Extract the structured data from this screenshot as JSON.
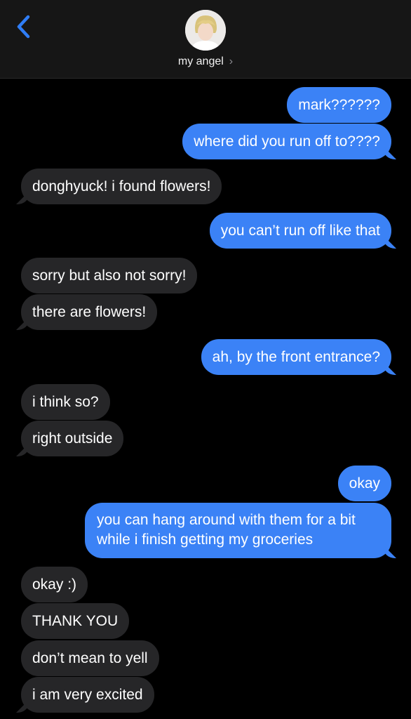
{
  "header": {
    "contact_name": "my angel",
    "chevron": "›"
  },
  "colors": {
    "sent_bubble": "#3b82f6",
    "received_bubble": "#262628",
    "accent": "#2f7df6"
  },
  "messages": [
    {
      "from": "me",
      "text": "mark??????"
    },
    {
      "from": "me",
      "text": "where did you run off to????"
    },
    {
      "from": "them",
      "text": "donghyuck! i found flowers!"
    },
    {
      "from": "me",
      "text": "you can’t run off like that"
    },
    {
      "from": "them",
      "text": "sorry but also not sorry!"
    },
    {
      "from": "them",
      "text": "there are flowers!"
    },
    {
      "from": "me",
      "text": "ah, by the front entrance?"
    },
    {
      "from": "them",
      "text": "i think so?"
    },
    {
      "from": "them",
      "text": "right outside"
    },
    {
      "from": "me",
      "text": "okay"
    },
    {
      "from": "me",
      "text": "you can hang around with them for a bit while i finish getting my groceries"
    },
    {
      "from": "them",
      "text": "okay :)"
    },
    {
      "from": "them",
      "text": "THANK YOU"
    },
    {
      "from": "them",
      "text": "don’t mean to yell"
    },
    {
      "from": "them",
      "text": "i am very excited"
    }
  ]
}
